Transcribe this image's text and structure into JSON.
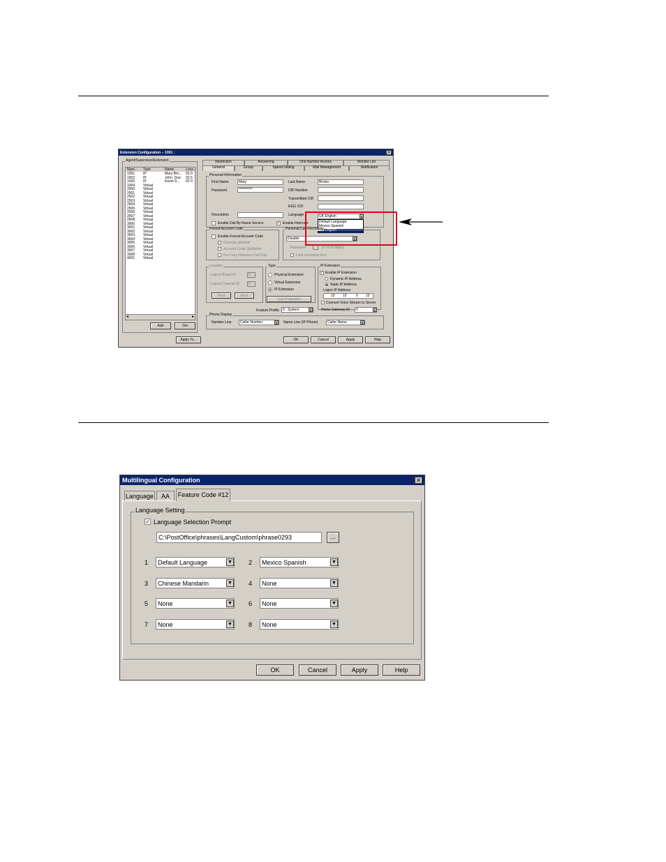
{
  "ext_dialog": {
    "title": "Extension Configuration -- 1001 :",
    "left_group": "Agent/Supervisor/Extension",
    "list_headers": [
      "Num...",
      "Type",
      "Name",
      "Loca"
    ],
    "list_rows": [
      [
        "1001",
        "IP",
        "Mary Bro...",
        "02.0"
      ],
      [
        "1002",
        "IP",
        "John. Doe",
        "02.5"
      ],
      [
        "1003",
        "IP",
        "Kevin S...",
        "02.0"
      ],
      [
        "1004",
        "Virtual",
        "",
        ""
      ],
      [
        "2500",
        "Virtual",
        "",
        ""
      ],
      [
        "2501",
        "Virtual",
        "",
        ""
      ],
      [
        "2502",
        "Virtual",
        "",
        ""
      ],
      [
        "2503",
        "Virtual",
        "",
        ""
      ],
      [
        "2504",
        "Virtual",
        "",
        ""
      ],
      [
        "2505",
        "Virtual",
        "",
        ""
      ],
      [
        "2506",
        "Virtual",
        "",
        ""
      ],
      [
        "2507",
        "Virtual",
        "",
        ""
      ],
      [
        "2508",
        "Virtual",
        "",
        ""
      ],
      [
        "3000",
        "Virtual",
        "",
        ""
      ],
      [
        "3001",
        "Virtual",
        "",
        ""
      ],
      [
        "3002",
        "Virtual",
        "",
        ""
      ],
      [
        "3003",
        "Virtual",
        "",
        ""
      ],
      [
        "3004",
        "Virtual",
        "",
        ""
      ],
      [
        "3005",
        "Virtual",
        "",
        ""
      ],
      [
        "3006",
        "Virtual",
        "",
        ""
      ],
      [
        "3007",
        "Virtual",
        "",
        ""
      ],
      [
        "3008",
        "Virtual",
        "",
        ""
      ],
      [
        "4001",
        "Virtual",
        "",
        ""
      ]
    ],
    "add": "Add",
    "del": "Del",
    "apply_to": "Apply To...",
    "tabs_back": [
      "Restriction",
      "Answering",
      "One Number Access",
      "Monitor List"
    ],
    "tabs_front": [
      "General",
      "Group",
      "Speed Dialing",
      "Mail Management",
      "Notification"
    ],
    "personal_info": "Personal Information",
    "first_name_label": "First Name",
    "first_name": "Mary",
    "last_name_label": "Last Name",
    "last_name": "Brown",
    "password_label": "Password",
    "password": "**********",
    "did_label": "DID Number",
    "transmitted_label": "Transmitted CID",
    "e911_label": "E911 CID",
    "language_label": "Language",
    "language_value": "UK English",
    "language_options": [
      "Default Language",
      "Mexico Spanish",
      "UK English"
    ],
    "description_label": "Description",
    "dial_by_name": "Enable Dial By Name Service",
    "intercom": "Enable Intercom",
    "forced_group": "Forced Account Code",
    "forced_enable": "Enable Forced Account Code",
    "forced_override": "Override allowed",
    "forced_validation": "Account Code Validation",
    "forced_ld": "For Long Distance Call Only",
    "pcr_group": "Personal Call Recording",
    "pcr_value": "Disable",
    "pcr_password": "Password",
    "pcr_hint": "(# of 10 digits)",
    "pcr_stored": "Limit recording time",
    "location_group": "Location",
    "logical_board": "Logical Board ID",
    "logical_channel": "Logical Channel ID",
    "location_board_val": "0",
    "location_channel_val": "0",
    "find_btn": "Find",
    "next_btn": "Next",
    "type_group": "Type",
    "type_physical": "Physical Extension",
    "type_virtual": "Virtual Extension",
    "type_ip": "IP Extension",
    "line_props": "Line Properties",
    "ip_group": "IP Extension",
    "ip_enable": "Enable IP Extension",
    "ip_dynamic": "Dynamic IP Address",
    "ip_static": "Static IP Address",
    "logon_ip": "Logon IP Address",
    "ip_octets": [
      "10",
      "10",
      "0",
      "10"
    ],
    "voice_stream": "Connect Voice Stream to Server",
    "home_gw": "Home Gateway ID",
    "home_gw_val": "0",
    "feature_profile": "Feature Profile",
    "feature_profile_val": "0 : System",
    "phone_display": "Phone Display",
    "number_line": "Number Line",
    "number_line_val": "Caller Number",
    "name_line": "Name Line (IP Phone)",
    "name_line_val": "Caller Name",
    "ok": "OK",
    "cancel": "Cancel",
    "apply": "Apply",
    "help": "Help"
  },
  "ml_dialog": {
    "title": "Multilingual Configuration",
    "tabs": [
      "Language",
      "AA",
      "Feature Code #12"
    ],
    "group": "Language Setting",
    "prompt_checkbox": "Language Selection Prompt",
    "path": "C:\\PostOffice\\phrases\\LangCustom\\phrase0293",
    "browse": "...",
    "slots": [
      {
        "num": "1",
        "value": "Default Language"
      },
      {
        "num": "2",
        "value": "Mexico Spanish"
      },
      {
        "num": "3",
        "value": "Chinese Mandarin"
      },
      {
        "num": "4",
        "value": "None"
      },
      {
        "num": "5",
        "value": "None"
      },
      {
        "num": "6",
        "value": "None"
      },
      {
        "num": "7",
        "value": "None"
      },
      {
        "num": "8",
        "value": "None"
      }
    ],
    "ok": "OK",
    "cancel": "Cancel",
    "apply": "Apply",
    "help": "Help"
  },
  "colors": {
    "titlebar": "#0a246a",
    "dialog": "#d4d0c8",
    "highlight_box": "#e0001a",
    "selection": "#0a246a"
  },
  "icons": {
    "close": "close-icon",
    "dropdown": "chevron-down-icon",
    "arrow": "arrow-left-icon",
    "checkmark": "checkmark-icon"
  }
}
